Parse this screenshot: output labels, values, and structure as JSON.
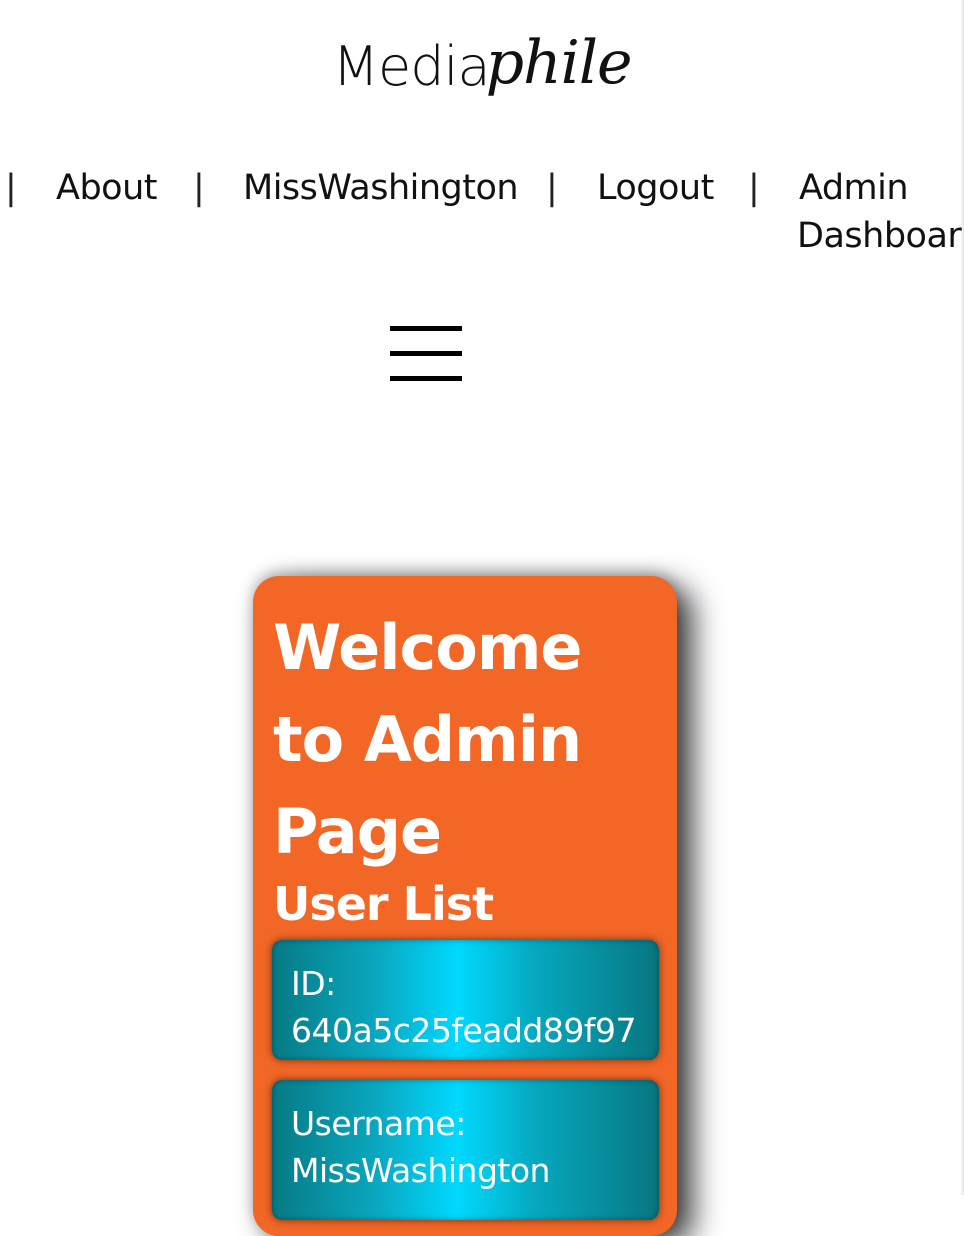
{
  "logo": {
    "part1": "Media",
    "part2": "phile"
  },
  "nav": {
    "separator": "|",
    "about": "About",
    "user": "MissWashington",
    "logout": "Logout",
    "admin_line1": "Admin",
    "admin_line2": "Dashboar"
  },
  "card": {
    "title": "Welcome to Admin Page",
    "subtitle": "User List",
    "fields": [
      {
        "label": "ID:",
        "value": "640a5c25feadd89f97"
      },
      {
        "label": "Username:",
        "value": "MissWashington"
      }
    ]
  }
}
